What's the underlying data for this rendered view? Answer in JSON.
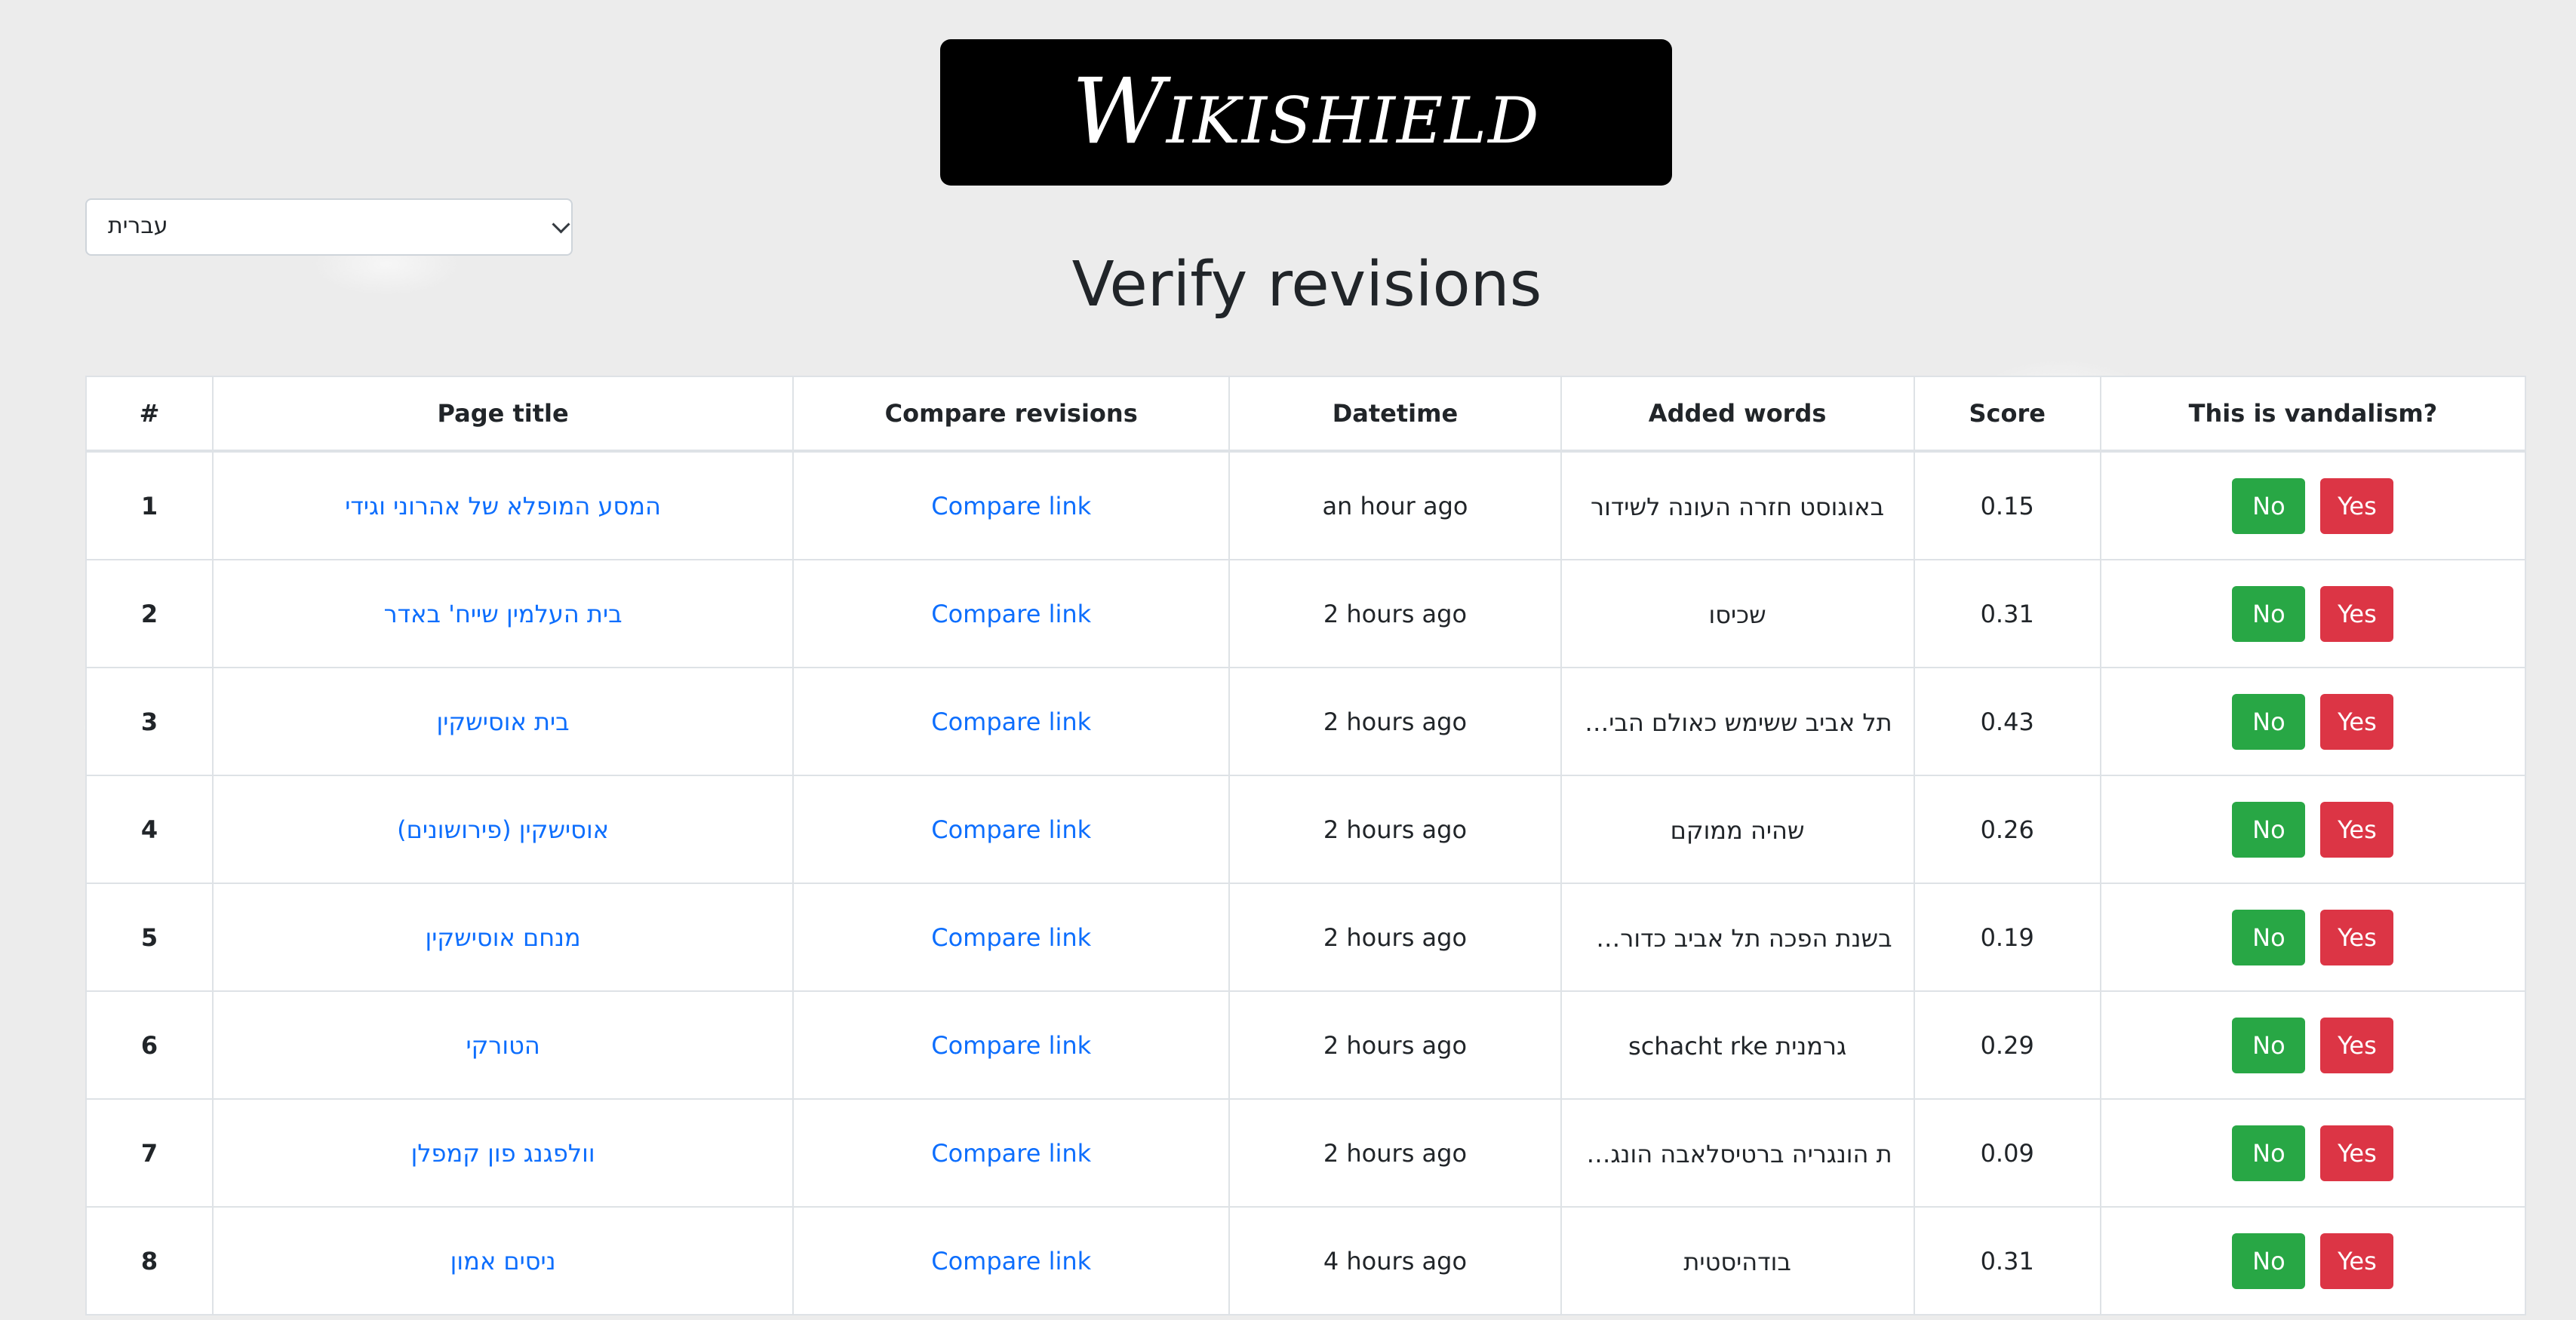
{
  "logo": {
    "text": "Wikishield"
  },
  "language_select": {
    "value": "עברית"
  },
  "page_title": "Verify revisions",
  "table": {
    "headers": [
      "#",
      "Page title",
      "Compare revisions",
      "Datetime",
      "Added words",
      "Score",
      "This is vandalism?"
    ],
    "rows": [
      {
        "num": "1",
        "title": "המסע המופלא של אהרוני וגידי",
        "compare": "Compare link",
        "datetime": "an hour ago",
        "added_words": "באוגוסט חזרה העונה לשידור",
        "score": "0.15",
        "no": "No",
        "yes": "Yes"
      },
      {
        "num": "2",
        "title": "בית העלמין שייח' באדר",
        "compare": "Compare link",
        "datetime": "2 hours ago",
        "added_words": "שכיסו",
        "score": "0.31",
        "no": "No",
        "yes": "Yes"
      },
      {
        "num": "3",
        "title": "בית אוסישקין",
        "compare": "Compare link",
        "datetime": "2 hours ago",
        "added_words": "תל אביב ששימש כאולם הבית...",
        "score": "0.43",
        "no": "No",
        "yes": "Yes"
      },
      {
        "num": "4",
        "title": "אוסישקין (פירושונים)",
        "compare": "Compare link",
        "datetime": "2 hours ago",
        "added_words": "שהיה ממוקם",
        "score": "0.26",
        "no": "No",
        "yes": "Yes"
      },
      {
        "num": "5",
        "title": "מנחם אוסישקין",
        "compare": "Compare link",
        "datetime": "2 hours ago",
        "added_words": "בשנת הפכה תל אביב כדורסל...",
        "score": "0.19",
        "no": "No",
        "yes": "Yes"
      },
      {
        "num": "6",
        "title": "הטורקי",
        "compare": "Compare link",
        "datetime": "2 hours ago",
        "added_words": "גרמנית schacht rke",
        "score": "0.29",
        "no": "No",
        "yes": "Yes"
      },
      {
        "num": "7",
        "title": "וולפגנג פון קמפלן",
        "compare": "Compare link",
        "datetime": "2 hours ago",
        "added_words": "ת הונגריה ברטיסלאבה הונגרי...",
        "score": "0.09",
        "no": "No",
        "yes": "Yes"
      },
      {
        "num": "8",
        "title": "ניסים אמון",
        "compare": "Compare link",
        "datetime": "4 hours ago",
        "added_words": "בודהיסטית",
        "score": "0.31",
        "no": "No",
        "yes": "Yes"
      }
    ]
  }
}
